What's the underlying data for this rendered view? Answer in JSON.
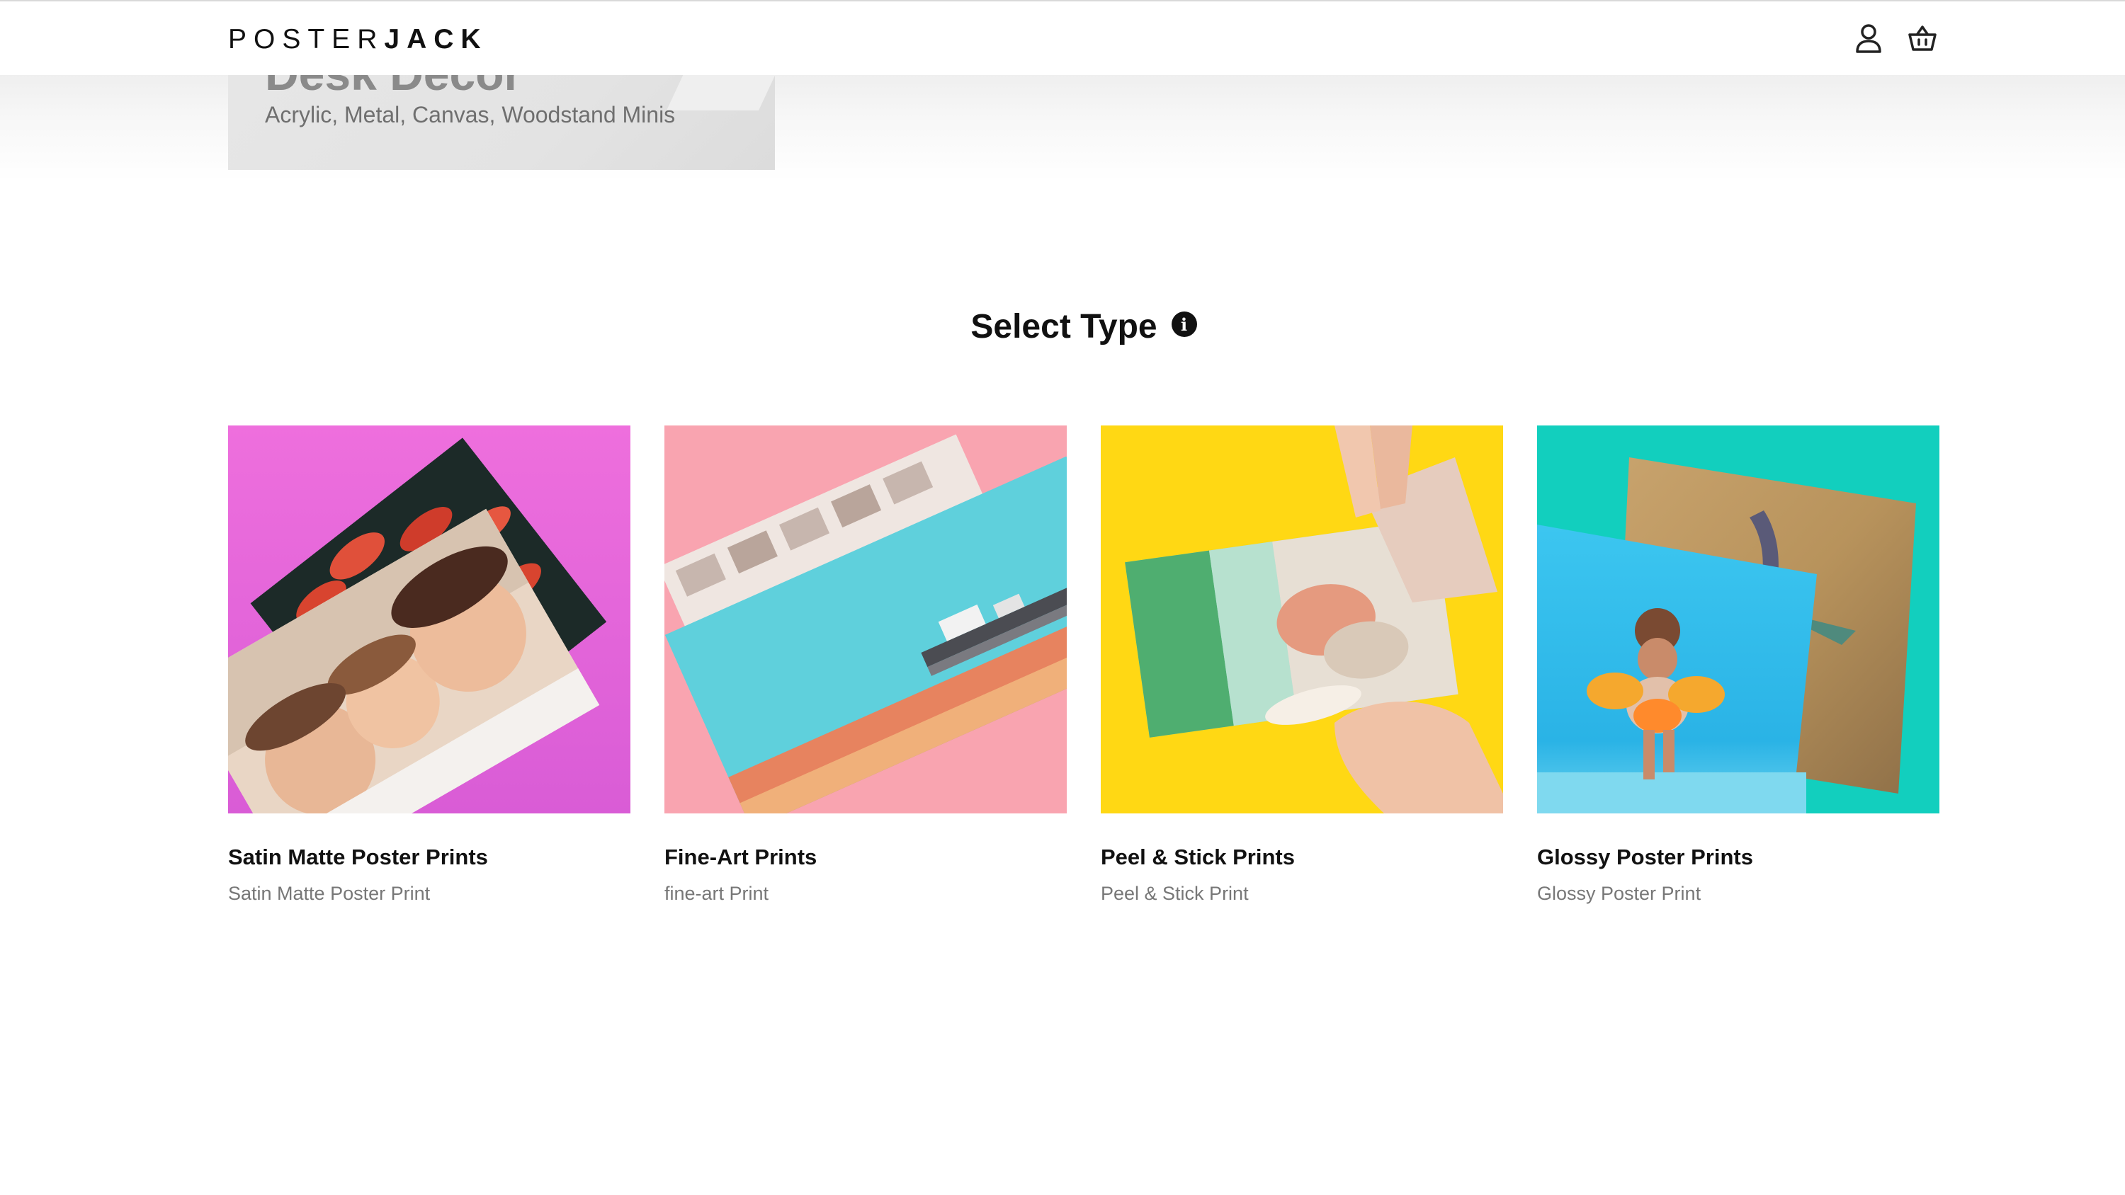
{
  "header": {
    "logo_light": "POSTER",
    "logo_bold": "JACK",
    "icons": [
      "account-icon",
      "cart-icon"
    ]
  },
  "banner": {
    "title": "Desk Decor",
    "subtitle": "Acrylic, Metal, Canvas, Woodstand Minis"
  },
  "section": {
    "title": "Select Type",
    "info_icon": "info-icon",
    "info_glyph": "i"
  },
  "products": [
    {
      "title": "Satin Matte Poster Prints",
      "subtitle": "Satin Matte Poster Print",
      "bg": "#ee6fdd"
    },
    {
      "title": "Fine-Art Prints",
      "subtitle": "fine-art Print",
      "bg": "#f9a4b0"
    },
    {
      "title": "Peel & Stick Prints",
      "subtitle": "Peel & Stick Print",
      "bg": "#ffd814"
    },
    {
      "title": "Glossy Poster Prints",
      "subtitle": "Glossy Poster Print",
      "bg": "#12cfbe"
    }
  ]
}
